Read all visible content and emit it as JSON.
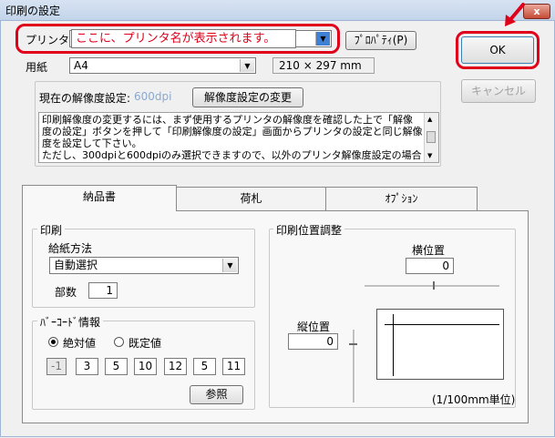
{
  "window": {
    "title": "印刷の設定",
    "close_glyph": "x"
  },
  "printer": {
    "label": "プリンタ",
    "message": "ここに、プリンタ名が表示されます。",
    "properties_button": "ﾌﾟﾛﾊﾟﾃｨ(P)"
  },
  "paper": {
    "label": "用紙",
    "selected": "A4",
    "size": "210 × 297 mm"
  },
  "buttons": {
    "ok": "OK",
    "cancel": "キャンセル"
  },
  "resolution": {
    "label": "現在の解像度設定:",
    "value": "600dpi",
    "change_button": "解像度設定の変更",
    "note_lines": [
      "印刷解像度の変更するには、まず使用するプリンタの解像度を確認した上で「解像",
      "度の設定」ボタンを押して「印刷解像度の設定」画面からプリンタの設定と同じ解像",
      "度を設定して下さい。",
      "ただし、300dpiと600dpiのみ選択できますので、以外のプリンタ解像度設定の場合"
    ]
  },
  "tabs": [
    "納品書",
    "荷札",
    "ｵﾌﾟｼｮﾝ"
  ],
  "print_group": {
    "title": "印刷",
    "feed_label": "給紙方法",
    "feed_selected": "自動選択",
    "copies_label": "部数",
    "copies_value": "1"
  },
  "barcode_group": {
    "title": "ﾊﾞｰｺｰﾄﾞ情報",
    "radio_absolute": "絶対値",
    "radio_preset": "既定値",
    "values": [
      "-1",
      "3",
      "5",
      "10",
      "12",
      "5",
      "11"
    ],
    "reference_button": "参照"
  },
  "position_group": {
    "title": "印刷位置調整",
    "horizontal_label": "横位置",
    "horizontal_value": "0",
    "vertical_label": "縦位置",
    "vertical_value": "0",
    "unit_note": "(1/100mm単位)"
  },
  "colors": {
    "highlight": "#e0001a",
    "dpi_text": "#8aa9d0"
  }
}
